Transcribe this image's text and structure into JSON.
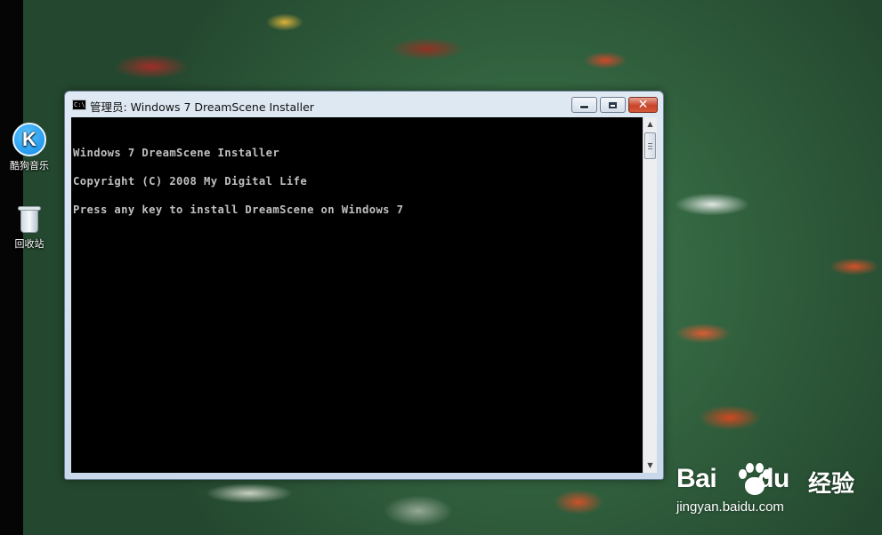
{
  "desktop": {
    "icons": [
      {
        "label": "酷狗音乐",
        "glyph": "K",
        "icon": "kugou-music-icon"
      },
      {
        "label": "回收站",
        "icon": "recycle-bin-icon"
      }
    ]
  },
  "window": {
    "title": "管理员:  Windows 7 DreamScene Installer",
    "icon_text": "C:\\",
    "close_glyph": "✕",
    "console_lines": [
      "Windows 7 DreamScene Installer",
      "Copyright (C) 2008 My Digital Life",
      "Press any key to install DreamScene on Windows 7"
    ],
    "scroll_up_glyph": "▲",
    "scroll_down_glyph": "▼"
  },
  "watermark": {
    "brand_left": "Bai",
    "brand_right": "du",
    "brand_cn": "经验",
    "url": "jingyan.baidu.com"
  }
}
